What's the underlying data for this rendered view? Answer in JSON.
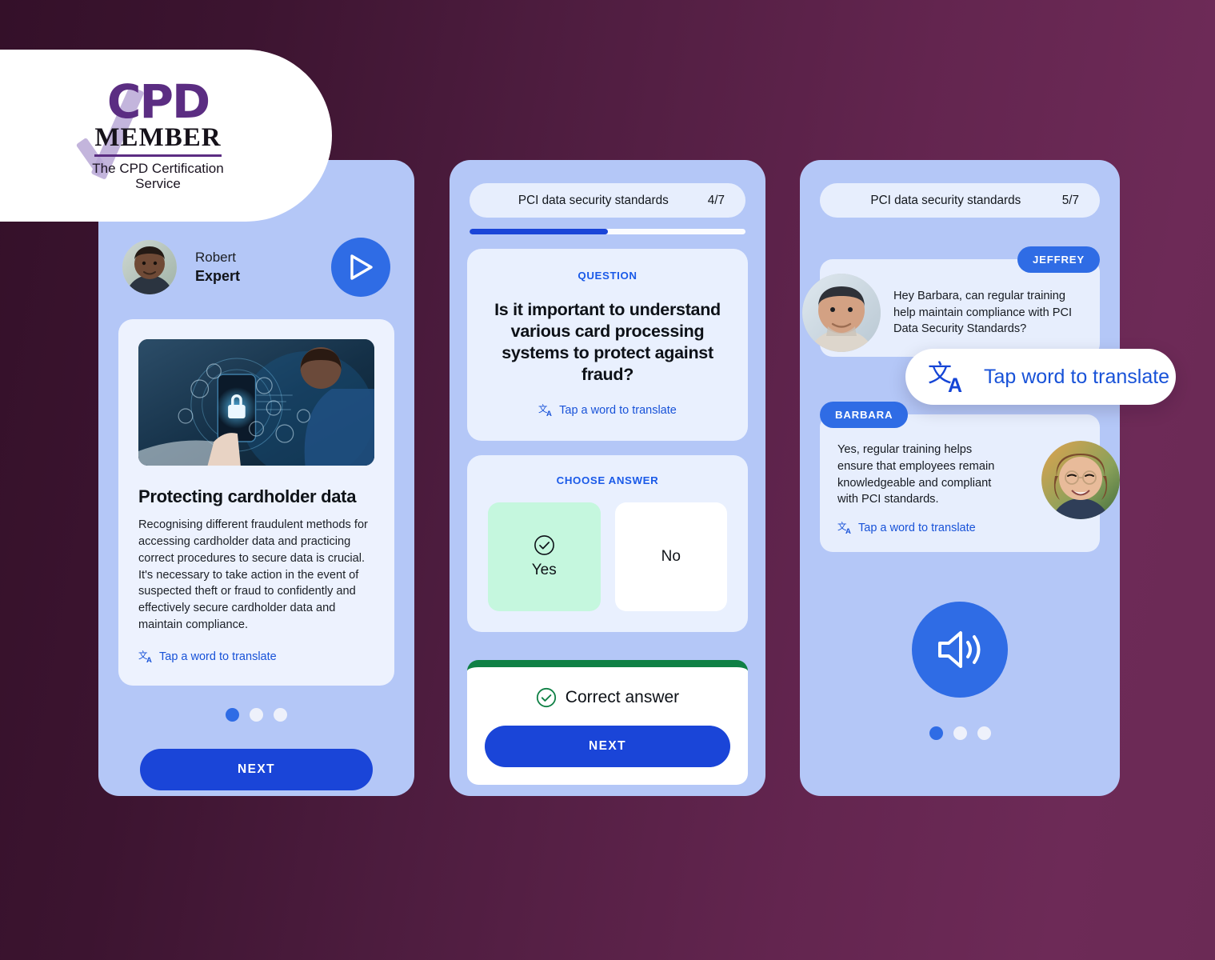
{
  "badge": {
    "title": "CPD",
    "member": "MEMBER",
    "subtitle": "The CPD Certification Service",
    "brand_color": "#5b2d82"
  },
  "colors": {
    "background_dark": "#341029",
    "background_light": "#6d2a57",
    "phone_bg": "#b4c7f7",
    "accent_blue": "#2f6ce5",
    "button_blue": "#1a45d8",
    "link_blue": "#1852d8",
    "correct_green": "#0f8045",
    "selected_green": "#c5f7de"
  },
  "screen1": {
    "presenter": {
      "name": "Robert",
      "role": "Expert",
      "avatar_icon": "avatar-photo"
    },
    "play_icon": "play-icon",
    "lesson": {
      "image_icon": "phone-security-lock-image",
      "title": "Protecting cardholder data",
      "body": "Recognising different fraudulent methods for accessing cardholder data and practicing correct procedures to secure data is crucial. It's necessary to take action in the event of suspected theft or fraud to confidently and effectively secure cardholder data and maintain compliance.",
      "translate_label": "Tap a word to translate",
      "translate_icon": "translate-icon"
    },
    "pagination": {
      "total": 3,
      "active": 1
    },
    "next_label": "NEXT"
  },
  "screen2": {
    "header": {
      "title": "PCI data security standards",
      "count": "4/7"
    },
    "progress_percent": 50,
    "question": {
      "label": "QUESTION",
      "text": "Is it important to understand various card processing systems to protect against fraud?",
      "translate_label": "Tap a word to translate",
      "translate_icon": "translate-icon"
    },
    "answers": {
      "label": "CHOOSE ANSWER",
      "options": [
        {
          "label": "Yes",
          "selected": true,
          "icon": "check-circle-icon"
        },
        {
          "label": "No",
          "selected": false,
          "icon": ""
        }
      ]
    },
    "result": {
      "status": "Correct answer",
      "status_icon": "check-circle-icon",
      "next_label": "NEXT"
    }
  },
  "screen3": {
    "header": {
      "title": "PCI data security standards",
      "count": "5/7"
    },
    "messages": [
      {
        "sender": "JEFFREY",
        "text": "Hey Barbara, can regular training help maintain compliance with PCI Data Security Standards?",
        "avatar_icon": "avatar-photo-jeffrey"
      },
      {
        "sender": "BARBARA",
        "text": "Yes, regular training helps ensure that employees remain knowledgeable and compliant with PCI standards.",
        "avatar_icon": "avatar-photo-barbara",
        "translate_label": "Tap a word to translate",
        "translate_icon": "translate-icon"
      }
    ],
    "speaker_icon": "speaker-volume-icon",
    "pagination": {
      "total": 3,
      "active": 1
    }
  },
  "floating_tooltip": {
    "label": "Tap word to translate",
    "icon": "translate-icon"
  }
}
